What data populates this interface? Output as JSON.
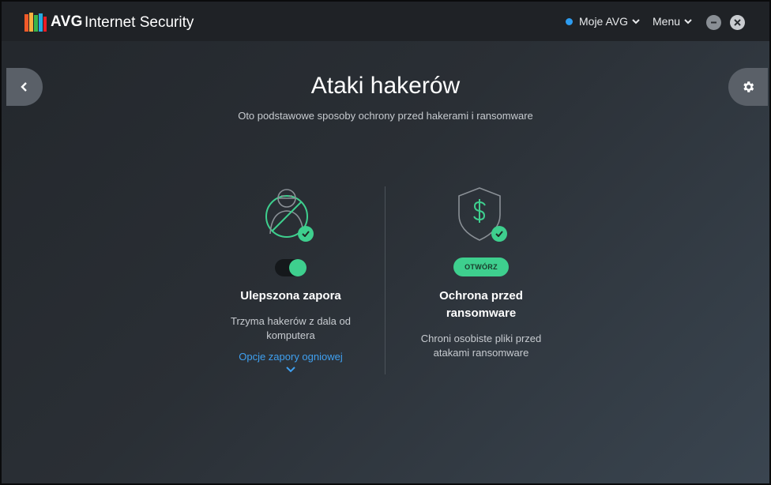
{
  "app": {
    "brand": "AVG",
    "product": "Internet Security"
  },
  "header": {
    "account_label": "Moje AVG",
    "menu_label": "Menu"
  },
  "page": {
    "title": "Ataki hakerów",
    "subtitle": "Oto podstawowe sposoby ochrony przed hakerami i ransomware"
  },
  "features": [
    {
      "title": "Ulepszona zapora",
      "description_lines": [
        "Trzyma hakerów z dala od",
        "komputera"
      ],
      "link": "Opcje zapory ogniowej",
      "toggle_on": true,
      "icon": "hacker-blocked-icon",
      "status": "check-icon"
    },
    {
      "title_lines": [
        "Ochrona przed",
        "ransomware"
      ],
      "description_lines": [
        "Chroni osobiste pliki przed",
        "atakami ransomware"
      ],
      "button": "OTWÓRZ",
      "icon": "shield-dollar-icon",
      "status": "check-icon"
    }
  ],
  "colors": {
    "accent_green": "#3ecf8e",
    "link_blue": "#3fa0f0",
    "status_dot": "#2d9cf0"
  }
}
